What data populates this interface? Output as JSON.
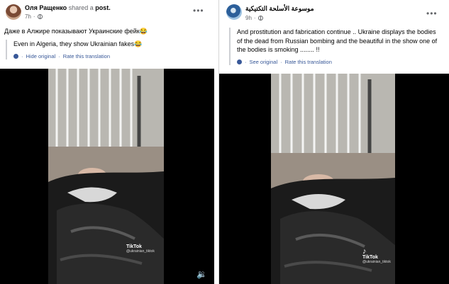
{
  "left_post": {
    "author": "Оля Ращенко",
    "action": "shared a",
    "object": "post.",
    "time": "7h",
    "text": "Даже в Алжире показывают Украинские фейк😂",
    "translation": "Even in Algeria, they show Ukrainian fakes😂",
    "hide_link": "Hide original",
    "rate_link": "Rate this translation",
    "more_icon": "more-horizontal-icon",
    "tiktok_label": "TikTok",
    "tiktok_handle": "@ukrainian_tiktok",
    "sound_icon": "volume-icon"
  },
  "right_post": {
    "author": "موسوعة الأسلحة التكتيكية",
    "time": "9h",
    "text": "And prostitution and fabrication continue .. Ukraine displays the bodies of the dead from Russian bombing and the beautiful in the show one of the bodies is smoking ........ !!",
    "see_link": "See original",
    "rate_link": "Rate this translation",
    "more_icon": "more-horizontal-icon",
    "tiktok_label": "TikTok",
    "tiktok_handle": "@ukrainian_tiktok"
  },
  "colors": {
    "link": "#385898",
    "secondary_text": "#65676b",
    "video_bg": "#000000"
  }
}
